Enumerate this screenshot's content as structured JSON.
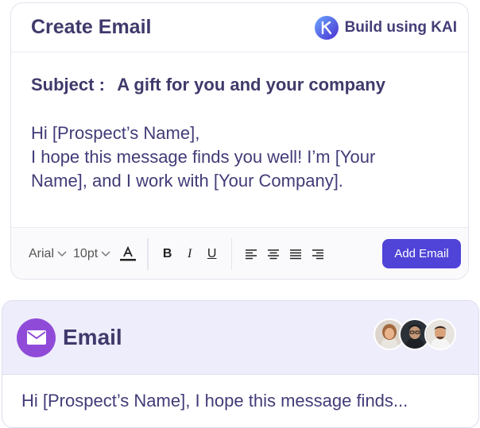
{
  "create_card": {
    "title": "Create Email",
    "kai_label": "Build using KAI",
    "subject_key": "Subject :",
    "subject_value": "A gift for you and your company",
    "greeting": "Hi [Prospect’s Name],",
    "body_line1": "I hope this message finds you well! I’m [Your",
    "body_line2": "Name], and I work with [Your Company]."
  },
  "toolbar": {
    "font_family": "Arial",
    "font_size": "10pt",
    "bold": "B",
    "italic": "I",
    "underline": "U",
    "add_label": "Add Email"
  },
  "email_card": {
    "title": "Email",
    "preview": "Hi [Prospect’s Name], I hope this message finds..."
  },
  "colors": {
    "accent": "#4f43d8",
    "mail_icon_bg": "#8f4bd8",
    "header_bg": "#eeedfb",
    "text": "#3f3a6b"
  },
  "icons": [
    "kai-logo-icon",
    "font-color-icon",
    "align-left-icon",
    "align-center-icon",
    "align-justify-icon",
    "align-right-icon",
    "mail-icon"
  ]
}
